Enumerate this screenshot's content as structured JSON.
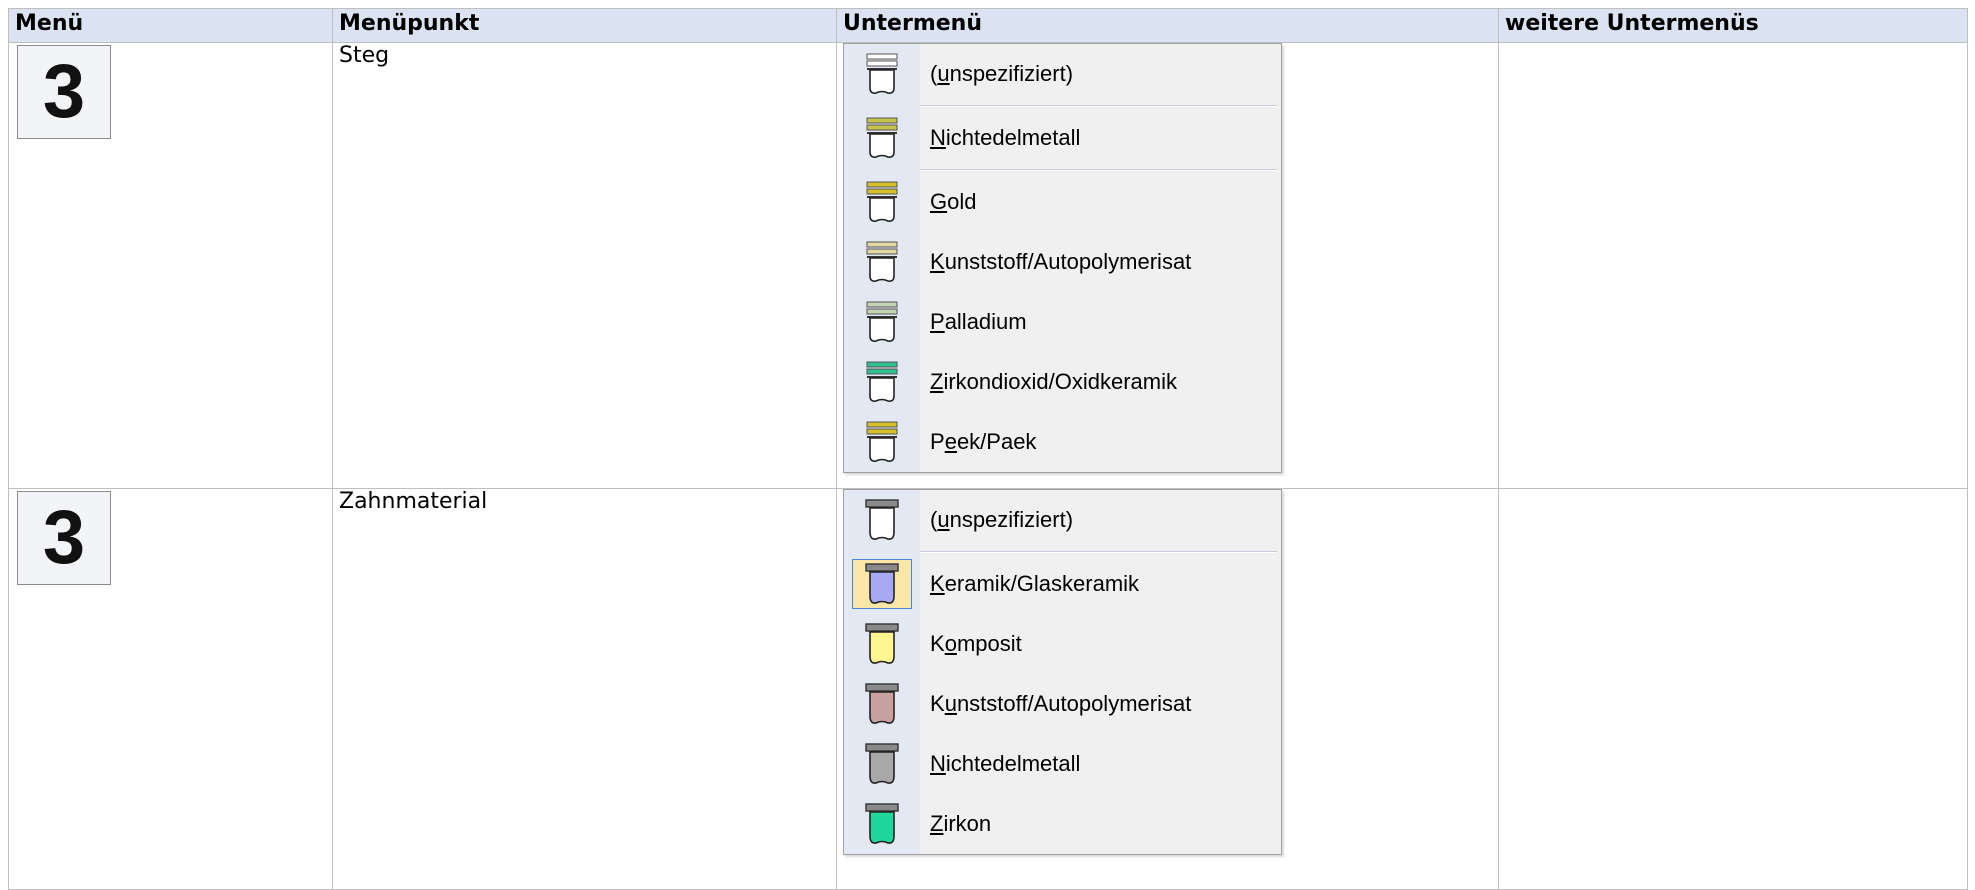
{
  "table": {
    "headers": {
      "menu": "Menü",
      "menuitem": "Menüpunkt",
      "submenu": "Untermenü",
      "further": "weitere Untermenüs"
    },
    "rows": [
      {
        "menu_number": "3",
        "menuitem": "Steg",
        "further": "",
        "submenu": {
          "items": [
            {
              "pre": "(",
              "u": "u",
              "post": "nspezifiziert)",
              "icon": "bar-unspecified-icon",
              "band": "#ffffff",
              "sep_after": true
            },
            {
              "pre": "",
              "u": "N",
              "post": "ichtedelmetall",
              "icon": "bar-base-metal-icon",
              "band": "#c8c24a",
              "sep_after": true
            },
            {
              "pre": "",
              "u": "G",
              "post": "old",
              "icon": "bar-gold-icon",
              "band": "#d4c12a",
              "sep_after": false
            },
            {
              "pre": "",
              "u": "K",
              "post": "unststoff/Autopolymerisat",
              "icon": "bar-plastic-icon",
              "band": "#e2d8a6",
              "sep_after": false
            },
            {
              "pre": "",
              "u": "P",
              "post": "alladium",
              "icon": "bar-palladium-icon",
              "band": "#c7d3b5",
              "sep_after": false
            },
            {
              "pre": "",
              "u": "Z",
              "post": "irkondioxid/Oxidkeramik",
              "icon": "bar-zirconia-icon",
              "band": "#2fbf8f",
              "sep_after": false
            },
            {
              "pre": "P",
              "u": "e",
              "post": "ek/Paek",
              "icon": "bar-peek-icon",
              "band": "#d4c12a",
              "sep_after": false
            }
          ]
        }
      },
      {
        "menu_number": "3",
        "menuitem": "Zahnmaterial",
        "further": "",
        "submenu": {
          "items": [
            {
              "pre": "(",
              "u": "u",
              "post": "nspezifiziert)",
              "icon": "tooth-unspecified-icon",
              "fill": "#ffffff",
              "sep_after": true,
              "selected": false
            },
            {
              "pre": "",
              "u": "K",
              "post": "eramik/Glaskeramik",
              "icon": "tooth-ceramic-icon",
              "fill": "#a7a9f2",
              "sep_after": false,
              "selected": true
            },
            {
              "pre": "K",
              "u": "o",
              "post": "mposit",
              "icon": "tooth-composite-icon",
              "fill": "#fff68f",
              "sep_after": false,
              "selected": false
            },
            {
              "pre": "K",
              "u": "u",
              "post": "nststoff/Autopolymerisat",
              "icon": "tooth-plastic-icon",
              "fill": "#c9a0a0",
              "sep_after": false,
              "selected": false
            },
            {
              "pre": "",
              "u": "N",
              "post": "ichtedelmetall",
              "icon": "tooth-base-metal-icon",
              "fill": "#a8a8a8",
              "sep_after": false,
              "selected": false
            },
            {
              "pre": "",
              "u": "Z",
              "post": "irkon",
              "icon": "tooth-zirconia-icon",
              "fill": "#1fd79a",
              "sep_after": false,
              "selected": false
            }
          ]
        }
      }
    ]
  }
}
